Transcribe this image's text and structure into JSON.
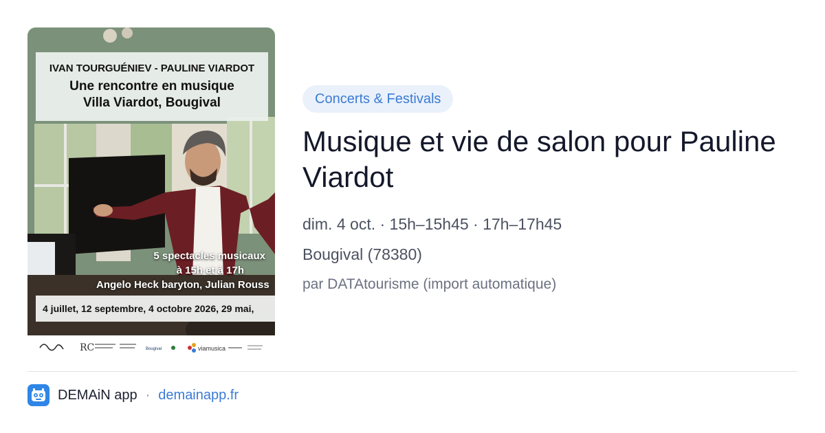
{
  "poster": {
    "title_line1": "IVAN TOURGUÉNIEV - PAULINE VIARDOT",
    "title_line2": "Une rencontre en musique",
    "title_line3": "Villa Viardot, Bougival",
    "mid_line1": "5 spectacles musicaux",
    "mid_line2": "à 15h et à 17h",
    "mid_line3": "Angelo Heck baryton, Julian Rouss",
    "dates": "4 juillet, 12 septembre, 4 octobre 2026, 29 mai,",
    "logo_text_1": "Bougival",
    "logo_text_2": "viamusica"
  },
  "event": {
    "category": "Concerts & Festivals",
    "title": "Musique et vie de salon pour Pauline Viardot",
    "datetime": "dim. 4 oct. · 15h–15h45 · 17h–17h45",
    "location": "Bougival (78380)",
    "source": "par DATAtourisme (import automatique)"
  },
  "footer": {
    "app_name": "DEMAiN app",
    "separator": "·",
    "domain": "demainapp.fr",
    "icon": "demain-app-icon"
  },
  "colors": {
    "badge_bg": "#eaf1fb",
    "accent": "#3b7bd4",
    "app_icon": "#2f86e6"
  }
}
